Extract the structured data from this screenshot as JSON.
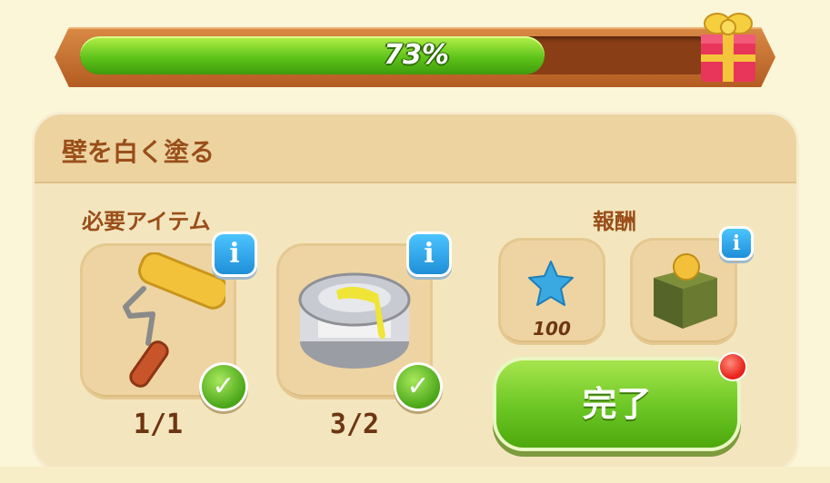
{
  "progress": {
    "percent_label": "73%",
    "value": 0.73
  },
  "panel": {
    "title": "壁を白く塗る",
    "required_label": "必要アイテム",
    "reward_label": "報酬"
  },
  "required_items": [
    {
      "name": "paint-roller",
      "count": "1/1",
      "info": "i"
    },
    {
      "name": "paint-can",
      "count": "3/2",
      "info": "i"
    }
  ],
  "rewards": [
    {
      "name": "blue-star",
      "count": "100"
    },
    {
      "name": "coin-box",
      "info": "i"
    }
  ],
  "complete_button": {
    "label": "完了"
  },
  "colors": {
    "accent_green": "#6bc624",
    "header_brown": "#9a4e1a",
    "info_blue": "#1f8fd8",
    "alert_red": "#e8231a"
  }
}
